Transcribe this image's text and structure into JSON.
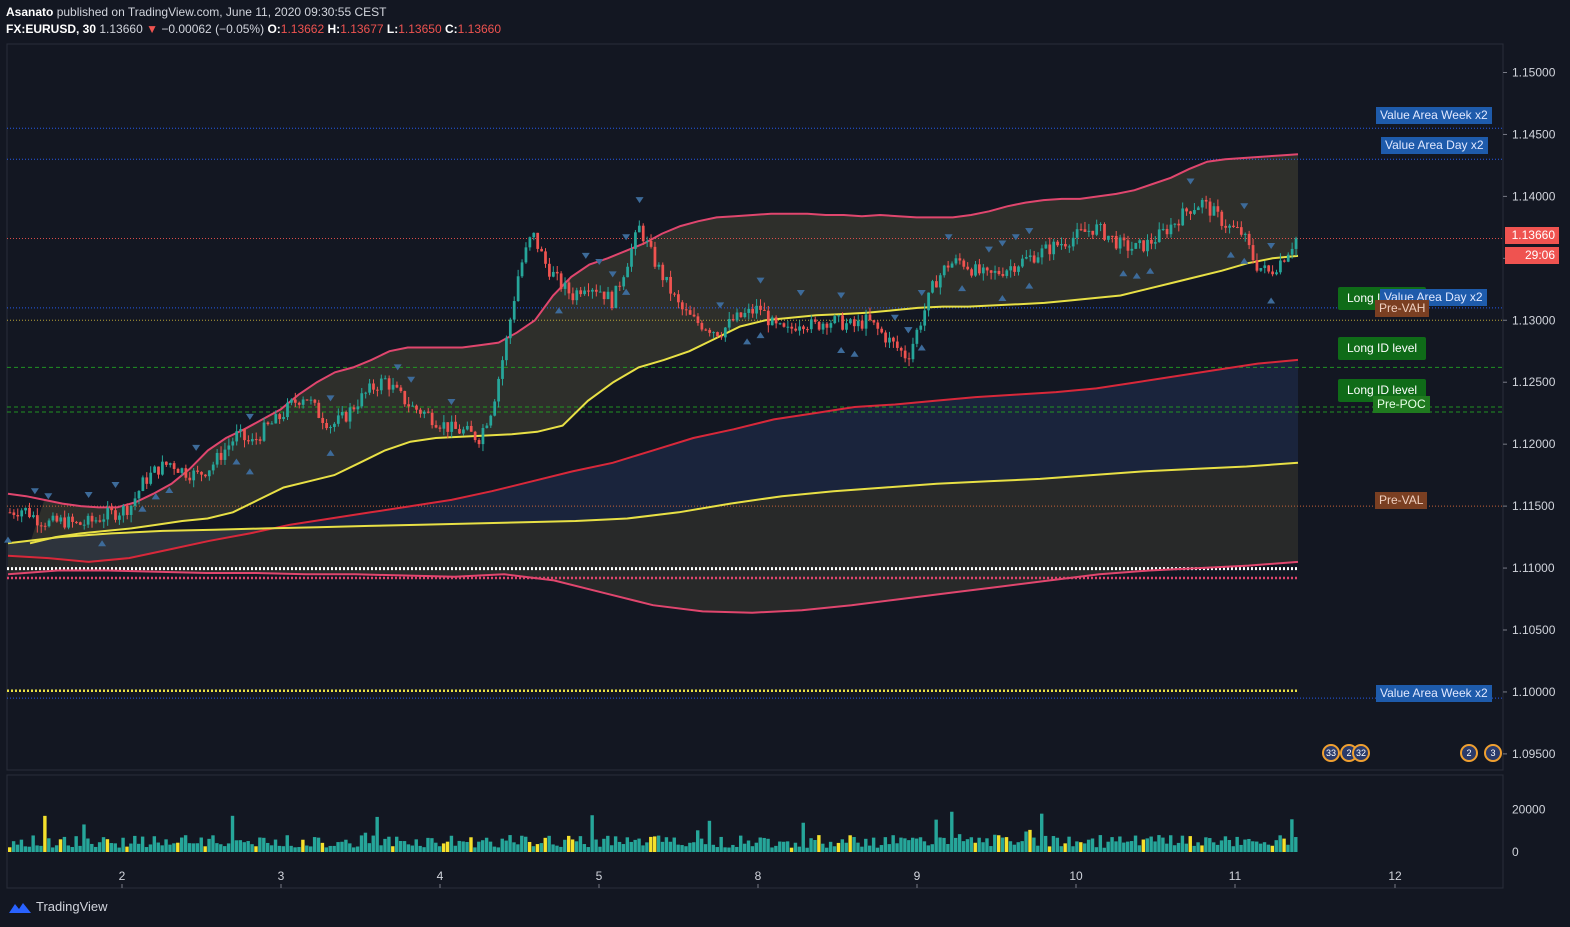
{
  "header": {
    "author": "Asanato",
    "published": "published on TradingView.com, June 11, 2020 09:30:55 CEST",
    "symbol": "FX:EURUSD, 30",
    "last": "1.13660",
    "change": "−0.00062 (−0.05%)",
    "o_label": "O:",
    "o_val": "1.13662",
    "h_label": "H:",
    "h_val": "1.13677",
    "l_label": "L:",
    "l_val": "1.13650",
    "c_label": "C:",
    "c_val": "1.13660"
  },
  "price_tag": {
    "price": "1.13660",
    "countdown": "29:06"
  },
  "labels": {
    "va_week_top": "Value Area Week x2",
    "va_day_top": "Value Area Day x2",
    "va_day_mid": "Value Area Day x2",
    "va_week_bottom": "Value Area Week x2",
    "long_id_1": "Long ID level",
    "long_id_2": "Long ID level",
    "long_id_3": "Long ID level",
    "pre_vah": "Pre-VAH",
    "pre_poc": "Pre-POC",
    "pre_val": "Pre-VAL"
  },
  "events": {
    "e1": "33",
    "e2": "2",
    "e3": "32",
    "e4": "2",
    "e5": "3"
  },
  "footer": {
    "brand": "TradingView"
  },
  "colors": {
    "background": "#131722",
    "up": "#26a69a",
    "down": "#ef5350",
    "band_pink": "#e0466e",
    "band_yellow": "#e8e045",
    "band_red": "#d8283a",
    "blue_line": "#2962ff",
    "volume_up": "#26a69a",
    "volume_highlight": "#f5e02c"
  },
  "chart_data": {
    "type": "line",
    "symbol": "FX:EURUSD",
    "interval": "30",
    "x_ticks": [
      "2",
      "3",
      "4",
      "5",
      "8",
      "9",
      "10",
      "11",
      "12"
    ],
    "y_ticks": [
      "1.15000",
      "1.14500",
      "1.14000",
      "1.13500",
      "1.13000",
      "1.12500",
      "1.12000",
      "1.11500",
      "1.11000",
      "1.10500",
      "1.10000",
      "1.09500"
    ],
    "ylim": [
      1.0937,
      1.1523
    ],
    "volume_ticks": [
      "20000",
      "0"
    ],
    "volume_lim": [
      0,
      34000
    ],
    "horizontal_levels": [
      {
        "name": "Value Area Week x2",
        "price": 1.1455,
        "color": "#2962ff"
      },
      {
        "name": "Value Area Day x2",
        "price": 1.143,
        "color": "#2962ff"
      },
      {
        "name": "Last price",
        "price": 1.1366,
        "color": "#ef5350"
      },
      {
        "name": "Value Area Day x2",
        "price": 1.131,
        "color": "#2962ff"
      },
      {
        "name": "Pre-VAH",
        "price": 1.13,
        "color": "#c9b23a"
      },
      {
        "name": "Long ID level",
        "price": 1.1262,
        "color": "#22a022"
      },
      {
        "name": "Long ID level",
        "price": 1.123,
        "color": "#22a022"
      },
      {
        "name": "Pre-POC",
        "price": 1.1226,
        "color": "#22a022"
      },
      {
        "name": "Pre-VAL",
        "price": 1.115,
        "color": "#d86a3a"
      },
      {
        "name": "Value Area Week x2",
        "price": 1.0995,
        "color": "#2962ff"
      }
    ],
    "series": [
      {
        "color": "#26a69a",
        "values": [
          1.1145,
          1.1148,
          1.114,
          1.1136,
          1.1138,
          1.1135,
          1.1137,
          1.1142,
          1.1145,
          1.115,
          1.117,
          1.118,
          1.1185,
          1.1178,
          1.1175,
          1.1182,
          1.1195,
          1.1208,
          1.12,
          1.1212,
          1.122,
          1.1232,
          1.124,
          1.1225,
          1.1215,
          1.1222,
          1.1235,
          1.1245,
          1.1252,
          1.124,
          1.123,
          1.1225,
          1.1218,
          1.1212,
          1.121,
          1.1205,
          1.123,
          1.128,
          1.134,
          1.137,
          1.1345,
          1.133,
          1.132,
          1.133,
          1.1325,
          1.1315,
          1.1345,
          1.1375,
          1.135,
          1.133,
          1.131,
          1.13,
          1.1295,
          1.129,
          1.13,
          1.1305,
          1.131,
          1.1295,
          1.129,
          1.13,
          1.1295,
          1.13,
          1.1298,
          1.1295,
          1.13,
          1.129,
          1.128,
          1.127,
          1.13,
          1.133,
          1.1345,
          1.1348,
          1.134,
          1.1335,
          1.134,
          1.1345,
          1.135,
          1.1355,
          1.136,
          1.1365,
          1.137,
          1.1375,
          1.1368,
          1.136,
          1.1358,
          1.1362,
          1.137,
          1.138,
          1.139,
          1.1395,
          1.1385,
          1.1375,
          1.137,
          1.1345,
          1.1338,
          1.135,
          1.1366
        ]
      },
      {
        "color": "#e0466e",
        "values": [
          1.116,
          1.1158,
          1.1155,
          1.1152,
          1.115,
          1.1149,
          1.1149,
          1.1153,
          1.116,
          1.1168,
          1.118,
          1.1195,
          1.1205,
          1.1212,
          1.122,
          1.1228,
          1.124,
          1.125,
          1.1258,
          1.1262,
          1.1268,
          1.1275,
          1.1278,
          1.1278,
          1.1278,
          1.1278,
          1.128,
          1.1282,
          1.129,
          1.13,
          1.132,
          1.1335,
          1.1345,
          1.135,
          1.1356,
          1.1362,
          1.137,
          1.1376,
          1.138,
          1.1383,
          1.1384,
          1.1385,
          1.1386,
          1.1386,
          1.1386,
          1.1385,
          1.1385,
          1.1384,
          1.1385,
          1.1384,
          1.1383,
          1.1383,
          1.1383,
          1.1385,
          1.1388,
          1.1392,
          1.1395,
          1.1397,
          1.1398,
          1.1398,
          1.14,
          1.1402,
          1.1405,
          1.141,
          1.1415,
          1.1422,
          1.1428,
          1.143,
          1.1431,
          1.1432,
          1.1433,
          1.1434
        ]
      },
      {
        "color": "#e8e045",
        "values": [
          1.112,
          1.1125,
          1.1128,
          1.113,
          1.1132,
          1.1135,
          1.1138,
          1.114,
          1.1145,
          1.1155,
          1.1165,
          1.117,
          1.1175,
          1.1185,
          1.1195,
          1.1202,
          1.1205,
          1.1206,
          1.1207,
          1.1208,
          1.121,
          1.1215,
          1.1235,
          1.125,
          1.1262,
          1.1268,
          1.1275,
          1.1285,
          1.1295,
          1.13,
          1.1302,
          1.1304,
          1.1305,
          1.1306,
          1.1308,
          1.131,
          1.1311,
          1.1311,
          1.1312,
          1.1313,
          1.1314,
          1.1316,
          1.1318,
          1.132,
          1.1325,
          1.133,
          1.1335,
          1.134,
          1.1346,
          1.135,
          1.1352
        ]
      },
      {
        "color": "#d8283a",
        "values": [
          1.111,
          1.1108,
          1.1105,
          1.1108,
          1.1115,
          1.1122,
          1.1128,
          1.1135,
          1.114,
          1.1145,
          1.115,
          1.1155,
          1.1162,
          1.117,
          1.1178,
          1.1185,
          1.1195,
          1.1205,
          1.1212,
          1.122,
          1.1225,
          1.123,
          1.1232,
          1.1235,
          1.1238,
          1.124,
          1.1242,
          1.1245,
          1.125,
          1.1255,
          1.126,
          1.1265,
          1.1268
        ]
      },
      {
        "color": "#e8e045",
        "values": [
          1.112,
          1.1125,
          1.1128,
          1.113,
          1.1131,
          1.1132,
          1.1133,
          1.1134,
          1.1135,
          1.1136,
          1.1137,
          1.1138,
          1.114,
          1.1145,
          1.1152,
          1.1158,
          1.1162,
          1.1165,
          1.1168,
          1.117,
          1.1172,
          1.1175,
          1.1178,
          1.118,
          1.1182,
          1.1185
        ]
      },
      {
        "color": "#e0466e",
        "values": [
          1.1095,
          1.1098,
          1.1098,
          1.1097,
          1.1096,
          1.1096,
          1.1095,
          1.1095,
          1.1094,
          1.1093,
          1.1095,
          1.109,
          1.108,
          1.107,
          1.1065,
          1.1064,
          1.1066,
          1.107,
          1.1075,
          1.108,
          1.1085,
          1.109,
          1.1095,
          1.1098,
          1.11,
          1.1102,
          1.1105
        ]
      }
    ]
  }
}
